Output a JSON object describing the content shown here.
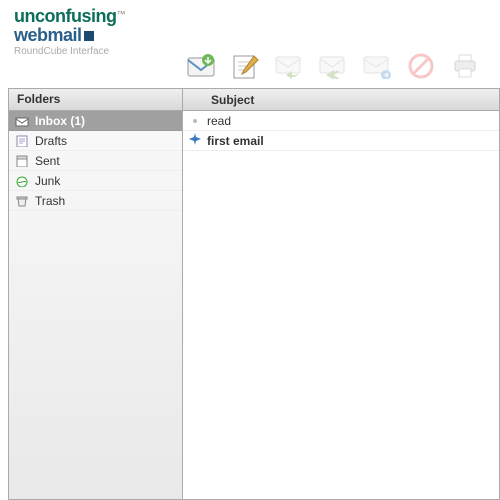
{
  "logo": {
    "line1": "unconfusing",
    "tm": "™",
    "line2": "webmail",
    "sub": "RoundCube Interface"
  },
  "toolbar": {
    "check": "check-mail",
    "compose": "compose",
    "reply": "reply",
    "replyall": "reply-all",
    "forward": "forward",
    "delete": "delete",
    "print": "print"
  },
  "sidebar": {
    "header": "Folders",
    "folders": [
      {
        "label": "Inbox (1)",
        "selected": true,
        "icon": "inbox"
      },
      {
        "label": "Drafts",
        "selected": false,
        "icon": "drafts"
      },
      {
        "label": "Sent",
        "selected": false,
        "icon": "sent"
      },
      {
        "label": "Junk",
        "selected": false,
        "icon": "junk"
      },
      {
        "label": "Trash",
        "selected": false,
        "icon": "trash"
      }
    ]
  },
  "messages": {
    "header": {
      "subject": "Subject"
    },
    "rows": [
      {
        "subject": "read",
        "unread": false
      },
      {
        "subject": "first email",
        "unread": true
      }
    ]
  }
}
